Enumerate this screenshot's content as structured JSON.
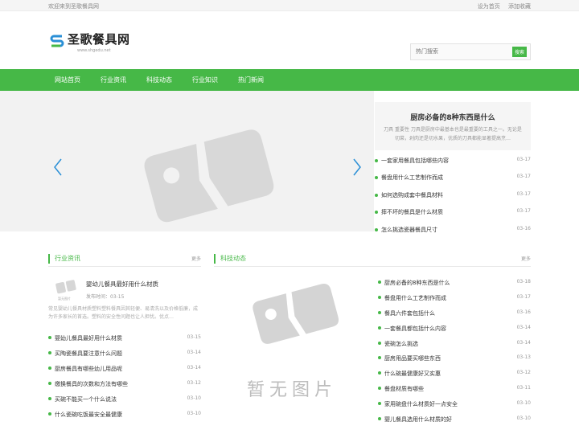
{
  "topbar": {
    "welcome": "欢迎来到圣歌餐具网",
    "set_home": "设为首页",
    "add_fav": "添加收藏"
  },
  "logo": {
    "text": "圣歌餐具网",
    "sub": "www.shgedu.net"
  },
  "search": {
    "placeholder": "热门搜索",
    "button": "搜索"
  },
  "nav": [
    {
      "label": "网站首页"
    },
    {
      "label": "行业资讯"
    },
    {
      "label": "科技动态"
    },
    {
      "label": "行业知识"
    },
    {
      "label": "热门新闻"
    }
  ],
  "hot": {
    "title": "厨房必备的8种东西是什么",
    "desc": "刀具 重要性 刀具是厨房中最基本也是最重要的工具之一。无论是切菜，剁肉还是切水果，优质的刀具都能显著提高烹…"
  },
  "right_list": [
    {
      "title": "一套家用餐具包括哪些内容",
      "date": "03-17"
    },
    {
      "title": "餐盘用什么工艺制作而成",
      "date": "03-17"
    },
    {
      "title": "如何选购成套中餐具材料",
      "date": "03-17"
    },
    {
      "title": "摔不坏的餐具是什么材质",
      "date": "03-17"
    },
    {
      "title": "怎么挑选瓷器餐具尺寸",
      "date": "03-16"
    }
  ],
  "sections": {
    "industry": {
      "title": "行业资讯",
      "more": "更多"
    },
    "tech": {
      "title": "科技动态",
      "more": "更多"
    }
  },
  "featured": {
    "title": "婴幼儿餐具最好用什么材质",
    "date": "发布时间：03-15",
    "desc": "常见婴幼儿餐具材质塑料塑料餐具因其轻便、易清洗以及价格低廉，成为许多家长的首选。塑料的安全性问题也让人担忧。优点…",
    "img_caption": "暂无图片"
  },
  "industry_list": [
    {
      "title": "婴幼儿餐具最好用什么材质",
      "date": "03-15"
    },
    {
      "title": "买陶瓷餐具要注意什么问题",
      "date": "03-14"
    },
    {
      "title": "厨房餐具有哪些幼儿用品呢",
      "date": "03-14"
    },
    {
      "title": "缴换餐具的次数和方法有哪些",
      "date": "03-12"
    },
    {
      "title": "买碗不能买一个什么说法",
      "date": "03-10"
    },
    {
      "title": "什么瓷碗吃饭最安全最健康",
      "date": "03-10"
    }
  ],
  "tech_list": [
    {
      "title": "厨房必备的8种东西是什么",
      "date": "03-18"
    },
    {
      "title": "餐盘用什么工艺制作而成",
      "date": "03-17"
    },
    {
      "title": "餐具六件套包括什么",
      "date": "03-16"
    },
    {
      "title": "一套餐具都包括什么内容",
      "date": "03-14"
    },
    {
      "title": "瓷碗怎么挑选",
      "date": "03-14"
    },
    {
      "title": "厨房用品要买哪些东西",
      "date": "03-13"
    },
    {
      "title": "什么碗最健康好又实惠",
      "date": "03-12"
    },
    {
      "title": "餐盘材质有哪些",
      "date": "03-11"
    },
    {
      "title": "家用碗盘什么材质好一点安全",
      "date": "03-10"
    },
    {
      "title": "婴儿餐具选用什么材质的好",
      "date": "03-10"
    }
  ],
  "placeholder_caption": "暂无图片",
  "colors": {
    "accent": "#46b847"
  }
}
